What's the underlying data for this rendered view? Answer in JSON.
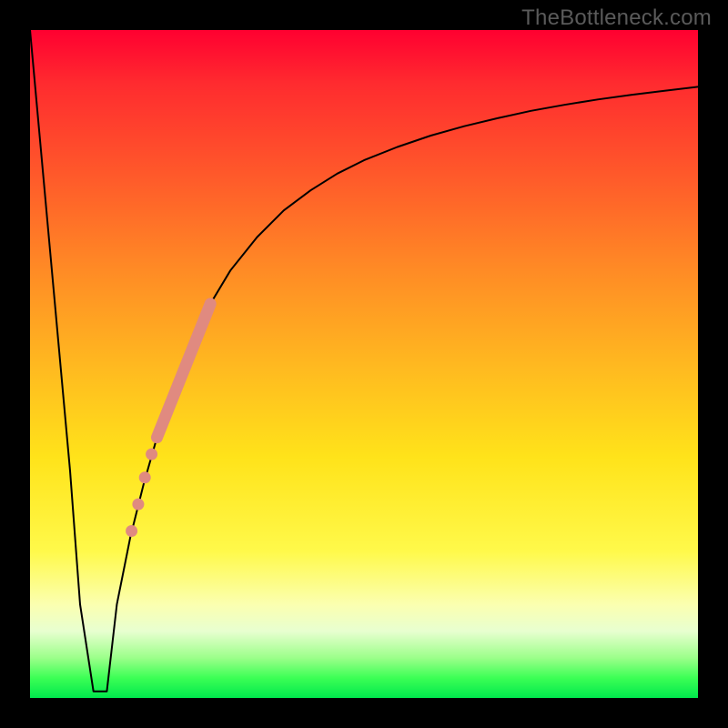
{
  "attribution": "TheBottleneck.com",
  "chart_data": {
    "type": "line",
    "title": "",
    "xlabel": "",
    "ylabel": "",
    "xlim": [
      0,
      100
    ],
    "ylim": [
      0,
      100
    ],
    "grid": false,
    "legend": false,
    "description": "Bottleneck-style curve: sharp V notch near x≈9 dropping to ~0, then a concave rise saturating near y≈92 at the right edge. Background is a red→green vertical gradient. A salmon-colored highlight segment with dots lies on the rising branch roughly between x≈15 and x≈27.",
    "series": [
      {
        "name": "curve",
        "x": [
          0,
          3,
          6,
          7.5,
          9.5,
          11.5,
          13,
          15,
          17,
          19,
          21,
          23,
          25,
          27,
          30,
          34,
          38,
          42,
          46,
          50,
          55,
          60,
          65,
          70,
          75,
          80,
          85,
          90,
          95,
          100
        ],
        "y": [
          100,
          67,
          34,
          14,
          1,
          1,
          14,
          24,
          32,
          39,
          45,
          50,
          55,
          59,
          64,
          69,
          73,
          76,
          78.5,
          80.5,
          82.5,
          84.2,
          85.6,
          86.8,
          87.9,
          88.8,
          89.6,
          90.3,
          90.9,
          91.5
        ]
      }
    ],
    "highlight": {
      "segment": {
        "x": [
          19,
          27
        ],
        "y": [
          39,
          59
        ]
      },
      "dots": [
        {
          "x": 15.2,
          "y": 25
        },
        {
          "x": 16.2,
          "y": 29
        },
        {
          "x": 17.2,
          "y": 33
        },
        {
          "x": 18.2,
          "y": 36.5
        }
      ]
    },
    "colors": {
      "curve": "#000000",
      "highlight": "#e08a80",
      "frame": "#000000"
    }
  }
}
